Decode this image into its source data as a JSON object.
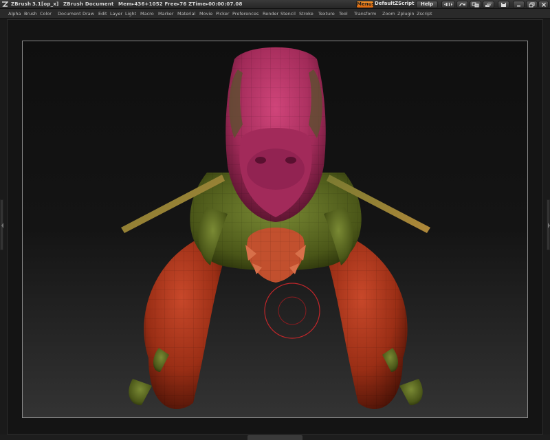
{
  "titlebar": {
    "app": "ZBrush",
    "version": "3.1[op_x]",
    "document": "ZBrush Document",
    "stats": "Mem▸436+1052 Free▸76 ZTime▸00:00:07.08",
    "menus_label": "Menus",
    "script_label": "DefaultZScript",
    "help_label": "Help"
  },
  "menu": {
    "items": [
      "Alpha",
      "Brush",
      "Color",
      "Document",
      "Draw",
      "Edit",
      "Layer",
      "Light",
      "Macro",
      "Marker",
      "Material",
      "Movie",
      "Picker",
      "Preferences",
      "Render",
      "Stencil",
      "Stroke",
      "Texture",
      "Tool",
      "Transform",
      "Zoom",
      "Zplugin",
      "Zscript"
    ]
  },
  "colors": {
    "accent": "#f0821e",
    "brush_cursor": "#c0262a",
    "mesh_pink": "#b8346a",
    "mesh_red": "#b2371a",
    "mesh_green": "#5c6e24"
  },
  "icons": [
    "zbrush-logo-icon",
    "layout-icon",
    "refresh-icon",
    "split-icon",
    "save-icon",
    "minimize-icon",
    "restore-icon",
    "close-icon"
  ]
}
